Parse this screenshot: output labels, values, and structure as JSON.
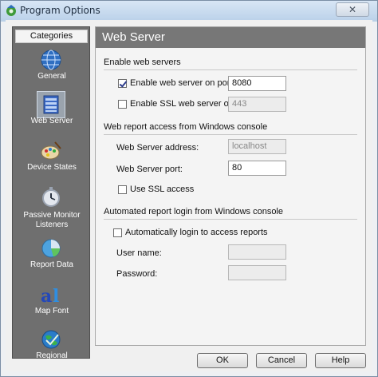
{
  "window": {
    "title": "Program Options",
    "close_glyph": "✕"
  },
  "sidebar": {
    "header": "Categories",
    "items": [
      {
        "label": "General",
        "icon": "globe-icon"
      },
      {
        "label": "Web Server",
        "icon": "server-icon"
      },
      {
        "label": "Device States",
        "icon": "palette-icon"
      },
      {
        "label_line1": "Passive Monitor",
        "label_line2": "Listeners",
        "icon": "stopwatch-icon"
      },
      {
        "label": "Report Data",
        "icon": "pie-chart-icon"
      },
      {
        "label": "Map Font",
        "icon": "font-icon"
      },
      {
        "label": "Regional",
        "icon": "regional-globe-icon"
      }
    ],
    "selected": "Web Server"
  },
  "panel": {
    "title": "Web Server",
    "enable_section": {
      "title": "Enable web servers",
      "enable_web": {
        "label": "Enable web server on port:",
        "checked": true,
        "value": "8080"
      },
      "enable_ssl": {
        "label": "Enable SSL web server on port:",
        "checked": false,
        "value": "443"
      }
    },
    "report_section": {
      "title": "Web report access from Windows console",
      "address": {
        "label": "Web Server address:",
        "value": "localhost"
      },
      "port": {
        "label": "Web Server port:",
        "value": "80"
      },
      "use_ssl": {
        "label": "Use SSL access",
        "checked": false
      }
    },
    "login_section": {
      "title": "Automated report login from Windows console",
      "auto_login": {
        "label": "Automatically login to access reports",
        "checked": false
      },
      "username": {
        "label": "User name:",
        "value": ""
      },
      "password": {
        "label": "Password:",
        "value": ""
      }
    }
  },
  "buttons": {
    "ok": "OK",
    "cancel": "Cancel",
    "help": "Help"
  }
}
